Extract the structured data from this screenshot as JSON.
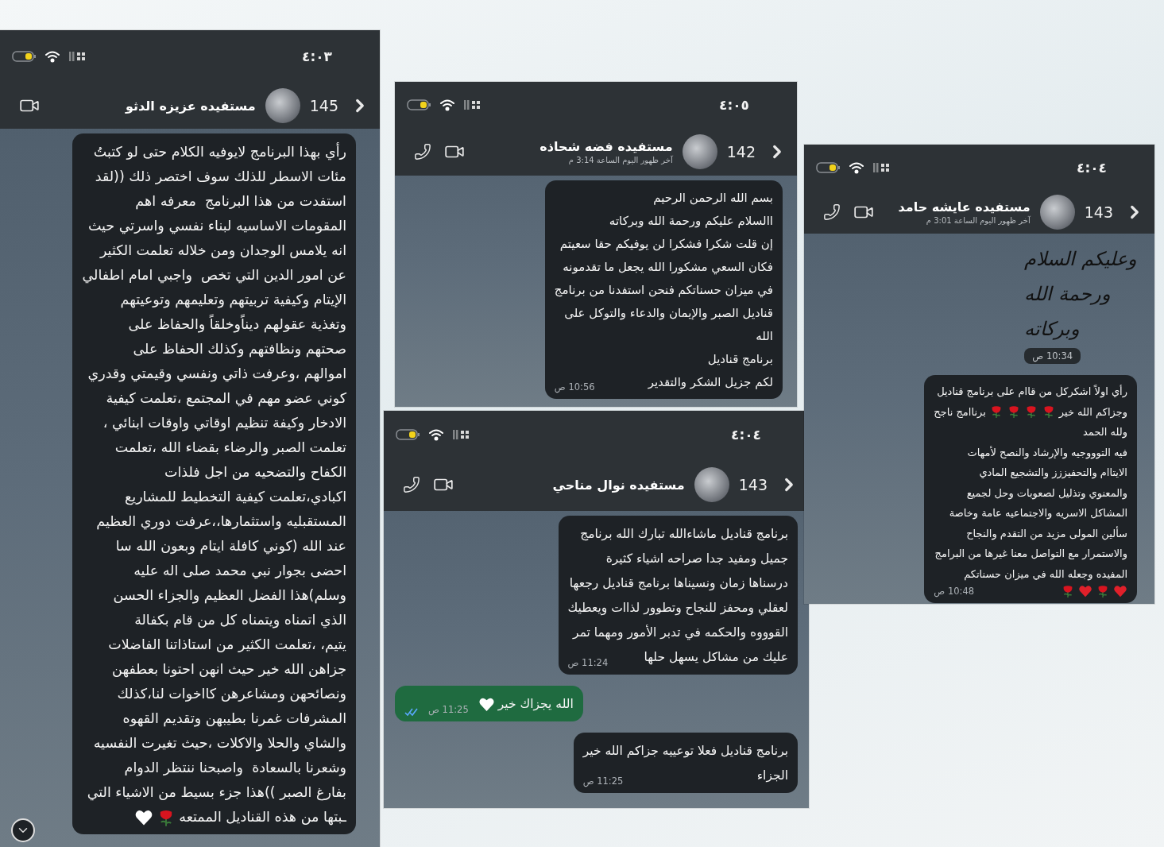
{
  "screens": [
    {
      "status_time": "٤:٠٣",
      "header": {
        "count": "145",
        "name": "مستفيده عزيزه الدثو"
      },
      "actions": [
        {
          "kind": "video"
        }
      ],
      "scroll_down_button": true,
      "messages": [
        {
          "kind": "incoming",
          "lines": [
            "رأي بهذا البرنامج لايوفيه الكلام حتى لو كتبتُ",
            "مئات الاسطر للذلك سوف اختصر ذلك ((لقد",
            "استفدت من هذا البرنامج  معرفه اهم",
            "المقومات الاساسيه لبناء نفسي واسرتي حيث",
            "انه يلامس الوجدان ومن خلاله تعلمت الكثير",
            "عن امور الدين التي تخص  واجبي امام اطفالي",
            "الإيتام وكيفية تربيتهم وتعليمهم وتوعيتهم",
            "وتغذية عقولهم ديناًوخلقاً والحفاظ على",
            "صحتهم ونظافتهم وكذلك الحفاظ على",
            "اموالهم ،وعرفت ذاتي ونفسي وقيمتي وقدري",
            "كوني عضو مهم في المجتمع ،تعلمت كيفية",
            "الادخار وكيفة تنظيم اوقاتي واوقات ابنائي ،",
            "تعلمت الصبر والرضاء بقضاء الله ،تعلمت",
            "الكفاح والتضحيه من اجل فلذات",
            "اكبادي،تعلمت كيفية التخطيط للمشاريع",
            "المستقبليه واستثمارها،،عرفت دوري العظيم",
            "عند الله (كوني كافلة ايتام وبعون الله سا",
            "احضى بجوار نبي محمد صلى اله عليه",
            "وسلم)هذا الفضل العظيم والجزاء الحسن",
            "الذي اتمناه ويتمناه كل من قام بكفالة",
            "يتيم، ،تعلمت الكثير من استاذاتنا الفاضلات",
            "جزاهن الله خير حيث انهن احتونا بعطفهن",
            "ونصائحهن ومشاعرهن كااخوات لنا،كذلك",
            "المشرفات غمرنا بطيبهن وتقديم القهوه",
            "والشاي والحلا والاكلات ،حيث تغيرت النفسيه",
            "وشعرنا بالسعادة  واصبحنا ننتظر الدوام",
            "بفارغ الصبر ))هذا جزء بسيط من الاشياء التي",
            {
              "parts": [
                {
                  "kind": "text",
                  "text": "ـبتها من هذه القناديل الممتعه"
                },
                {
                  "kind": "rose"
                },
                {
                  "kind": "heart",
                  "color": "#ffffff"
                }
              ]
            }
          ]
        }
      ]
    },
    {
      "status_time": "٤:٠٥",
      "header": {
        "count": "142",
        "name": "مستفيده فضه شحاذه",
        "subtitle": "آخر ظهور اليوم الساعة 3:14 م"
      },
      "actions": [
        {
          "kind": "video"
        },
        {
          "kind": "phone"
        }
      ],
      "messages": [
        {
          "kind": "incoming",
          "time": "10:56 ص",
          "lines": [
            "بسم الله الرحمن الرحيم",
            "االسلام عليكم ورحمة الله وبركاته",
            "إن قلت شكرا فشكرا لن يوفيكم حقا سعيتم",
            "فكان السعي مشكورا الله يجعل ما تقدمونه",
            "في ميزان حسناتكم فنحن استفدنا من برنامج",
            "قناديل الصبر والإيمان والدعاء والتوكل على",
            "الله",
            "برنامج قناديل",
            "لكم جزيل الشكر والتقدير"
          ]
        }
      ]
    },
    {
      "status_time": "٤:٠٤",
      "header": {
        "count": "143",
        "name": "مستفيده نوال مناحي"
      },
      "actions": [
        {
          "kind": "video"
        },
        {
          "kind": "phone"
        }
      ],
      "messages": [
        {
          "kind": "incoming",
          "time": "11:24 ص",
          "lines": [
            "برنامج قناديل ماشاءالله تبارك الله برنامج",
            "جميل ومفيد جدا صراحه اشياء كثيرة",
            "درسناها زمان ونسيناها برنامج قناديل رجعها",
            "لعقلي ومحفز للنجاح وتطوور لذاات ويعطيك",
            "القوووه والحكمه في تدبر الأمور ومهما تمر",
            "عليك من مشاكل يسهل حلها"
          ]
        },
        {
          "kind": "outgoing",
          "time": "11:25 ص",
          "read": true,
          "lines": [
            {
              "parts": [
                {
                  "kind": "text",
                  "text": "الله يجزاك خير"
                },
                {
                  "kind": "heart",
                  "color": "#ffffff"
                }
              ]
            }
          ]
        },
        {
          "kind": "incoming",
          "time": "11:25 ص",
          "lines": [
            "برنامج قناديل فعلا توعييه جزاكم الله خير",
            "الجزاء"
          ]
        }
      ]
    },
    {
      "status_time": "٤:٠٤",
      "header": {
        "count": "143",
        "name": "مستفيده عايشه حامد",
        "subtitle": "آخر ظهور اليوم الساعة 3:01 م"
      },
      "actions": [
        {
          "kind": "video"
        },
        {
          "kind": "phone"
        }
      ],
      "messages": [
        {
          "kind": "sticker",
          "time": "10:34 ص",
          "lines": [
            "وعليكم السلام",
            "ورحمة الله",
            "وبركاته"
          ]
        },
        {
          "kind": "incoming",
          "time": "10:48 ص",
          "lines": [
            "رأي اولاً اشكركل من قاام على برنامج قناديل",
            {
              "parts": [
                {
                  "kind": "text",
                  "text": "وجزاكم الله خير"
                },
                {
                  "kind": "rose"
                },
                {
                  "kind": "rose"
                },
                {
                  "kind": "rose"
                },
                {
                  "kind": "rose"
                },
                {
                  "kind": "text",
                  "text": "برناامج ناجح"
                }
              ]
            },
            "ولله الحمد",
            "فيه التوووجيه والإرشاد والنصح لأمهات",
            "الايتاام والتحفيززز والتشجيع المادي",
            "والمعنوي وتذليل لصعوبات وحل لجميع",
            "المشاكل الاسريه والاجتماعيه عامة وخاصة",
            "سألين المولى مزيد من التقدم والنجاح",
            "والاستمرار مع التواصل معنا غيرها من البرامج",
            "المفيده وجعله الله في ميزان حسناتكم",
            {
              "parts": [
                {
                  "kind": "heart",
                  "color": "#e0202a"
                },
                {
                  "kind": "rose"
                },
                {
                  "kind": "heart",
                  "color": "#e0202a"
                },
                {
                  "kind": "rose"
                }
              ]
            }
          ]
        }
      ]
    }
  ]
}
